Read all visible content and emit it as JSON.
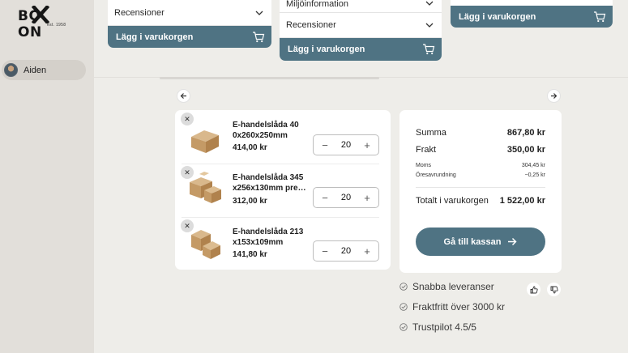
{
  "brand": {
    "name": "BOXON",
    "tagline": "est. 1958"
  },
  "user": {
    "name": "Aiden"
  },
  "products_strip": {
    "cards": [
      {
        "dropdown": "Recensioner",
        "cart_label": "Lägg i varukorgen"
      },
      {
        "dropdown_top": "Miljöinformation",
        "dropdown": "Recensioner",
        "cart_label": "Lägg i varukorgen"
      },
      {
        "cart_label": "Lägg i varukorgen"
      }
    ]
  },
  "cart": {
    "items": [
      {
        "name": "E-handelslåda 40 0x260x250mm",
        "price": "414,00 kr",
        "quantity": "20"
      },
      {
        "name": "E-handelslåda 345 x256x130mm pre…",
        "price": "312,00 kr",
        "quantity": "20"
      },
      {
        "name": "E-handelslåda 213 x153x109mm",
        "price": "141,80 kr",
        "quantity": "20"
      }
    ]
  },
  "summary": {
    "summa_label": "Summa",
    "summa_value": "867,80 kr",
    "frakt_label": "Frakt",
    "frakt_value": "350,00 kr",
    "moms_label": "Moms",
    "moms_value": "304,45 kr",
    "rounding_label": "Öresavrundning",
    "rounding_value": "−0,25 kr",
    "total_label": "Totalt i varukorgen",
    "total_value": "1 522,00 kr",
    "checkout_label": "Gå till kassan"
  },
  "usps": [
    "Snabba leveranser",
    "Fraktfritt över 3000 kr",
    "Trustpilot 4.5/5"
  ],
  "colors": {
    "accent": "#4f7383",
    "sidebar": "#e2dfda",
    "background": "#eeede9"
  }
}
